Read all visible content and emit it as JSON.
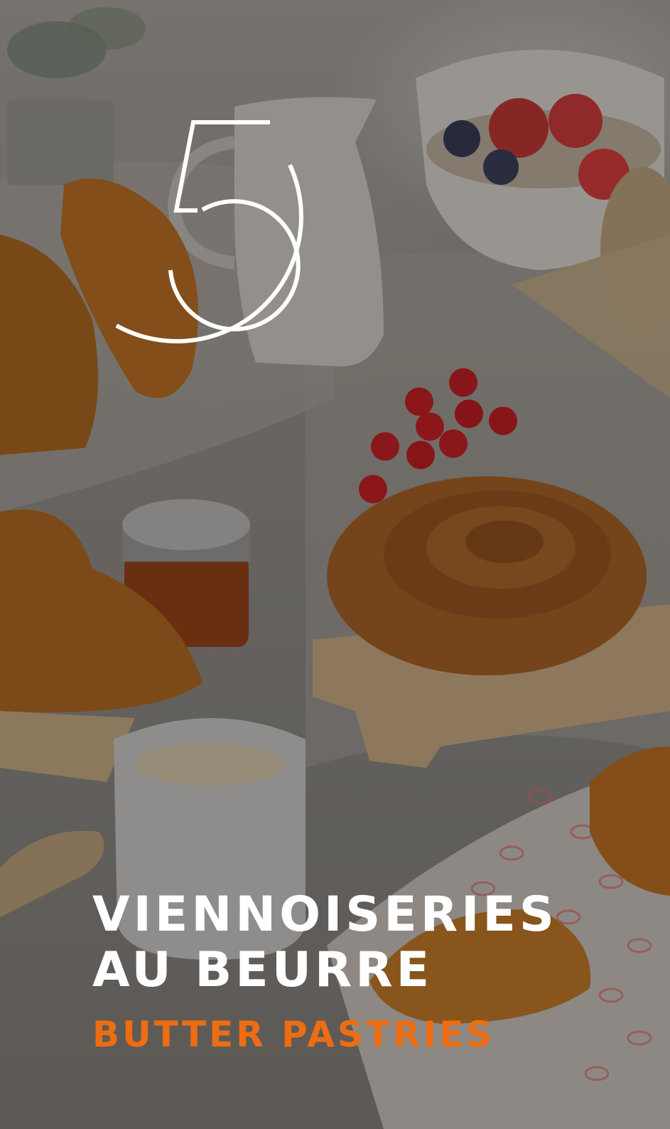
{
  "poster": {
    "number_mark": "5",
    "title_lines": [
      "VIENNOISERIES",
      "AU BEURRE"
    ],
    "subtitle": "BUTTER PASTRIES",
    "colors": {
      "title": "#ffffff",
      "subtitle": "#ee6d12",
      "mark_stroke": "#ffffff"
    },
    "photo_subject": "breakfast-pastries-table"
  }
}
